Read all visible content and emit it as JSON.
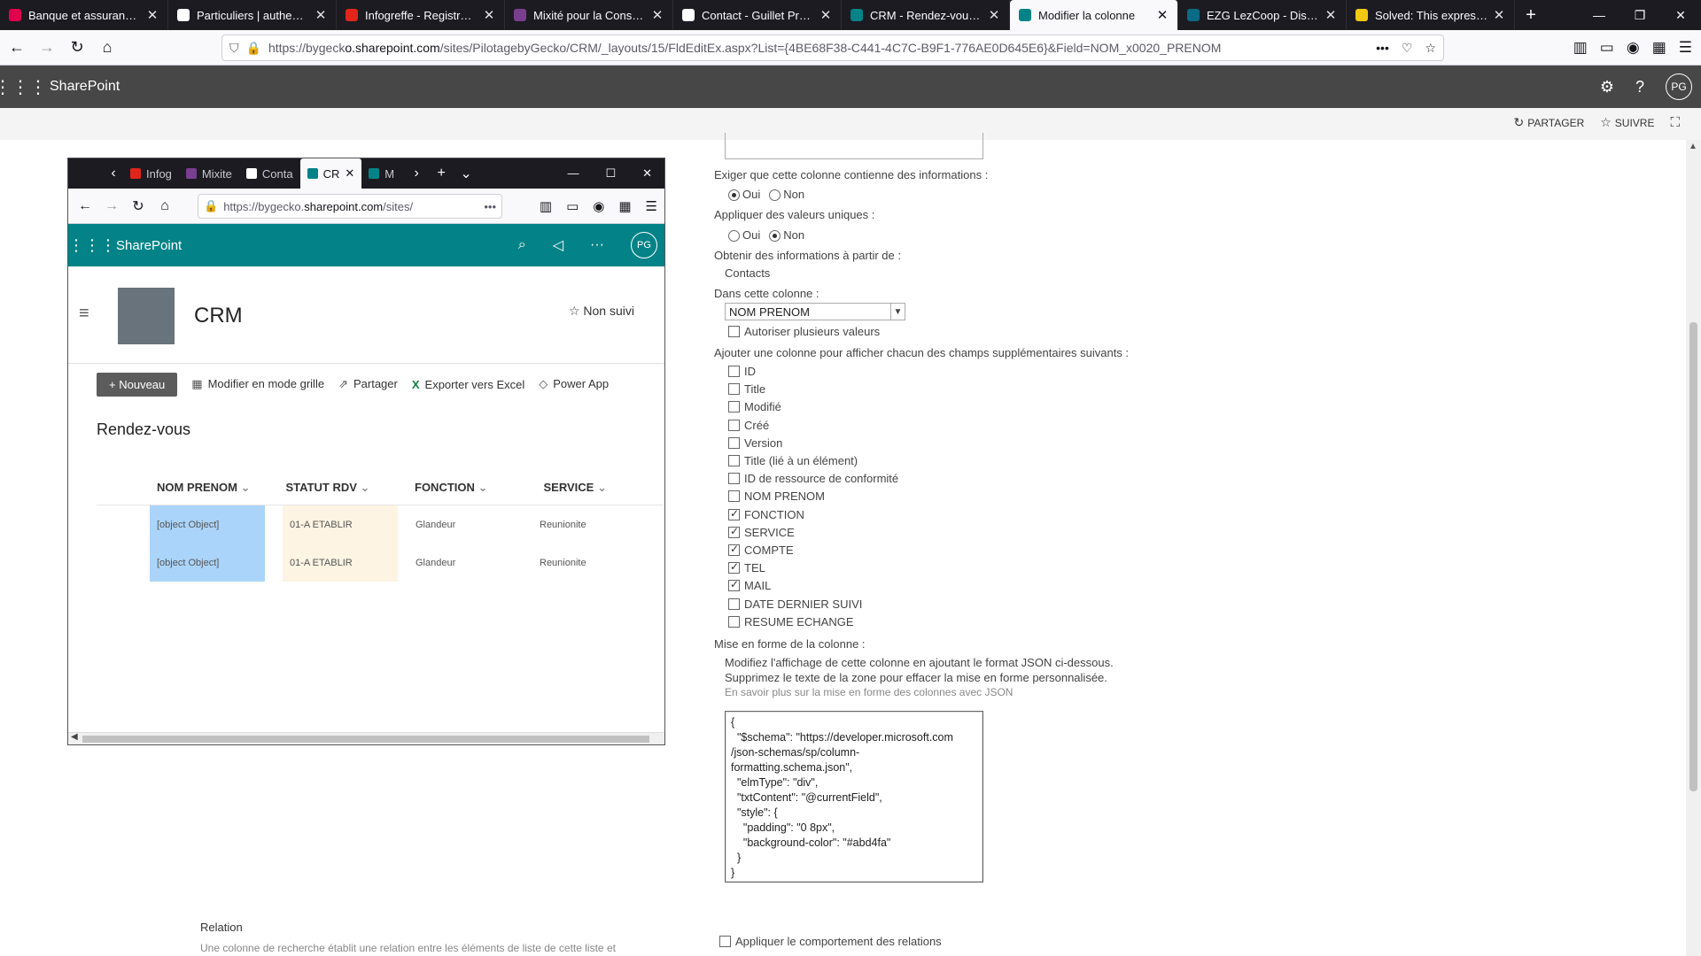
{
  "browser": {
    "tabs": [
      {
        "label": "Banque et assurance - P",
        "color": "#e0004d"
      },
      {
        "label": "Particuliers | authentific",
        "color": "#ffffff"
      },
      {
        "label": "Infogreffe - Registre du c",
        "color": "#e1251b"
      },
      {
        "label": "Mixité pour la Construct",
        "color": "#7a3e8f"
      },
      {
        "label": "Contact - Guillet Produc",
        "color": "#ffffff"
      },
      {
        "label": "CRM - Rendez-vous - To",
        "color": "#038387"
      },
      {
        "label": "Modifier la colonne",
        "color": "#038387",
        "active": true
      },
      {
        "label": "EZG LezCoop - Discussio",
        "color": "#0b6a85"
      },
      {
        "label": "Solved: This expression",
        "color": "#f2c811"
      }
    ],
    "url_prefix": "https://bygeck",
    "url_domain": "o.sharepoint.com",
    "url_rest": "/sites/PilotagebyGecko/CRM/_layouts/15/FldEditEx.aspx?List={4BE68F38-C441-4C7C-B9F1-776AE0D645E6}&Field=NOM_x0020_PRENOM"
  },
  "suite": {
    "brand": "SharePoint",
    "avatar": "PG"
  },
  "actions": {
    "share": "PARTAGER",
    "follow": "SUIVRE"
  },
  "inner": {
    "tabs": [
      "Infog",
      "Mixite",
      "Conta",
      "CR",
      "M"
    ],
    "url_prefix": "https://bygecko.",
    "url_domain": "sharepoint.com",
    "url_rest": "/sites/",
    "brand": "SharePoint",
    "avatar": "PG",
    "site_title": "CRM",
    "follow": "Non suivi",
    "commands": {
      "new": "Nouveau",
      "grid": "Modifier en mode grille",
      "share": "Partager",
      "excel": "Exporter vers Excel",
      "power": "Power App"
    },
    "view_title": "Rendez-vous",
    "columns": [
      "NOM PRENOM",
      "STATUT RDV",
      "FONCTION",
      "SERVICE"
    ],
    "rows": [
      [
        "[object Object]",
        "01-A ETABLIR",
        "Glandeur",
        "Reunionite"
      ],
      [
        "[object Object]",
        "01-A ETABLIR",
        "Glandeur",
        "Reunionite"
      ]
    ]
  },
  "form": {
    "required_label": "Exiger que cette colonne contienne des informations :",
    "unique_label": "Appliquer des valeurs uniques :",
    "yes": "Oui",
    "no": "Non",
    "source_label": "Obtenir des informations à partir de :",
    "source_value": "Contacts",
    "column_label": "Dans cette colonne :",
    "column_value": "NOM PRENOM",
    "allow_multiple": "Autoriser plusieurs valeurs",
    "extra_fields_label": "Ajouter une colonne pour afficher chacun des champs supplémentaires suivants :",
    "extra_fields": [
      {
        "label": "ID",
        "checked": false
      },
      {
        "label": "Title",
        "checked": false
      },
      {
        "label": "Modifié",
        "checked": false
      },
      {
        "label": "Créé",
        "checked": false
      },
      {
        "label": "Version",
        "checked": false
      },
      {
        "label": "Title (lié à un élément)",
        "checked": false
      },
      {
        "label": "ID de ressource de conformité",
        "checked": false
      },
      {
        "label": "NOM PRENOM",
        "checked": false
      },
      {
        "label": "FONCTION",
        "checked": true
      },
      {
        "label": "SERVICE",
        "checked": true
      },
      {
        "label": "COMPTE",
        "checked": true
      },
      {
        "label": "TEL",
        "checked": true
      },
      {
        "label": "MAIL",
        "checked": true
      },
      {
        "label": "DATE DERNIER SUIVI",
        "checked": false
      },
      {
        "label": "RESUME ECHANGE",
        "checked": false
      }
    ],
    "format_label": "Mise en forme de la colonne :",
    "format_help1": "Modifiez l'affichage de cette colonne en ajoutant le format JSON ci-dessous.",
    "format_help2": "Supprimez le texte de la zone pour effacer la mise en forme personnalisée.",
    "format_link": "En savoir plus sur la mise en forme des colonnes avec JSON",
    "json_lines": [
      "{",
      "  \"$schema\": \"https://developer.microsoft.com",
      "/json-schemas/sp/column-",
      "formatting.schema.json\",",
      "  \"elmType\": \"div\",",
      "  \"txtContent\": \"@currentField\",",
      "  \"style\": {",
      "    \"padding\": \"0 8px\",",
      "    \"background-color\": \"#abd4fa\"",
      "  }",
      "}"
    ],
    "relation_title": "Relation",
    "relation_desc": "Une colonne de recherche établit une relation entre les éléments de liste de cette liste et",
    "relation_checkbox": "Appliquer le comportement des relations"
  }
}
